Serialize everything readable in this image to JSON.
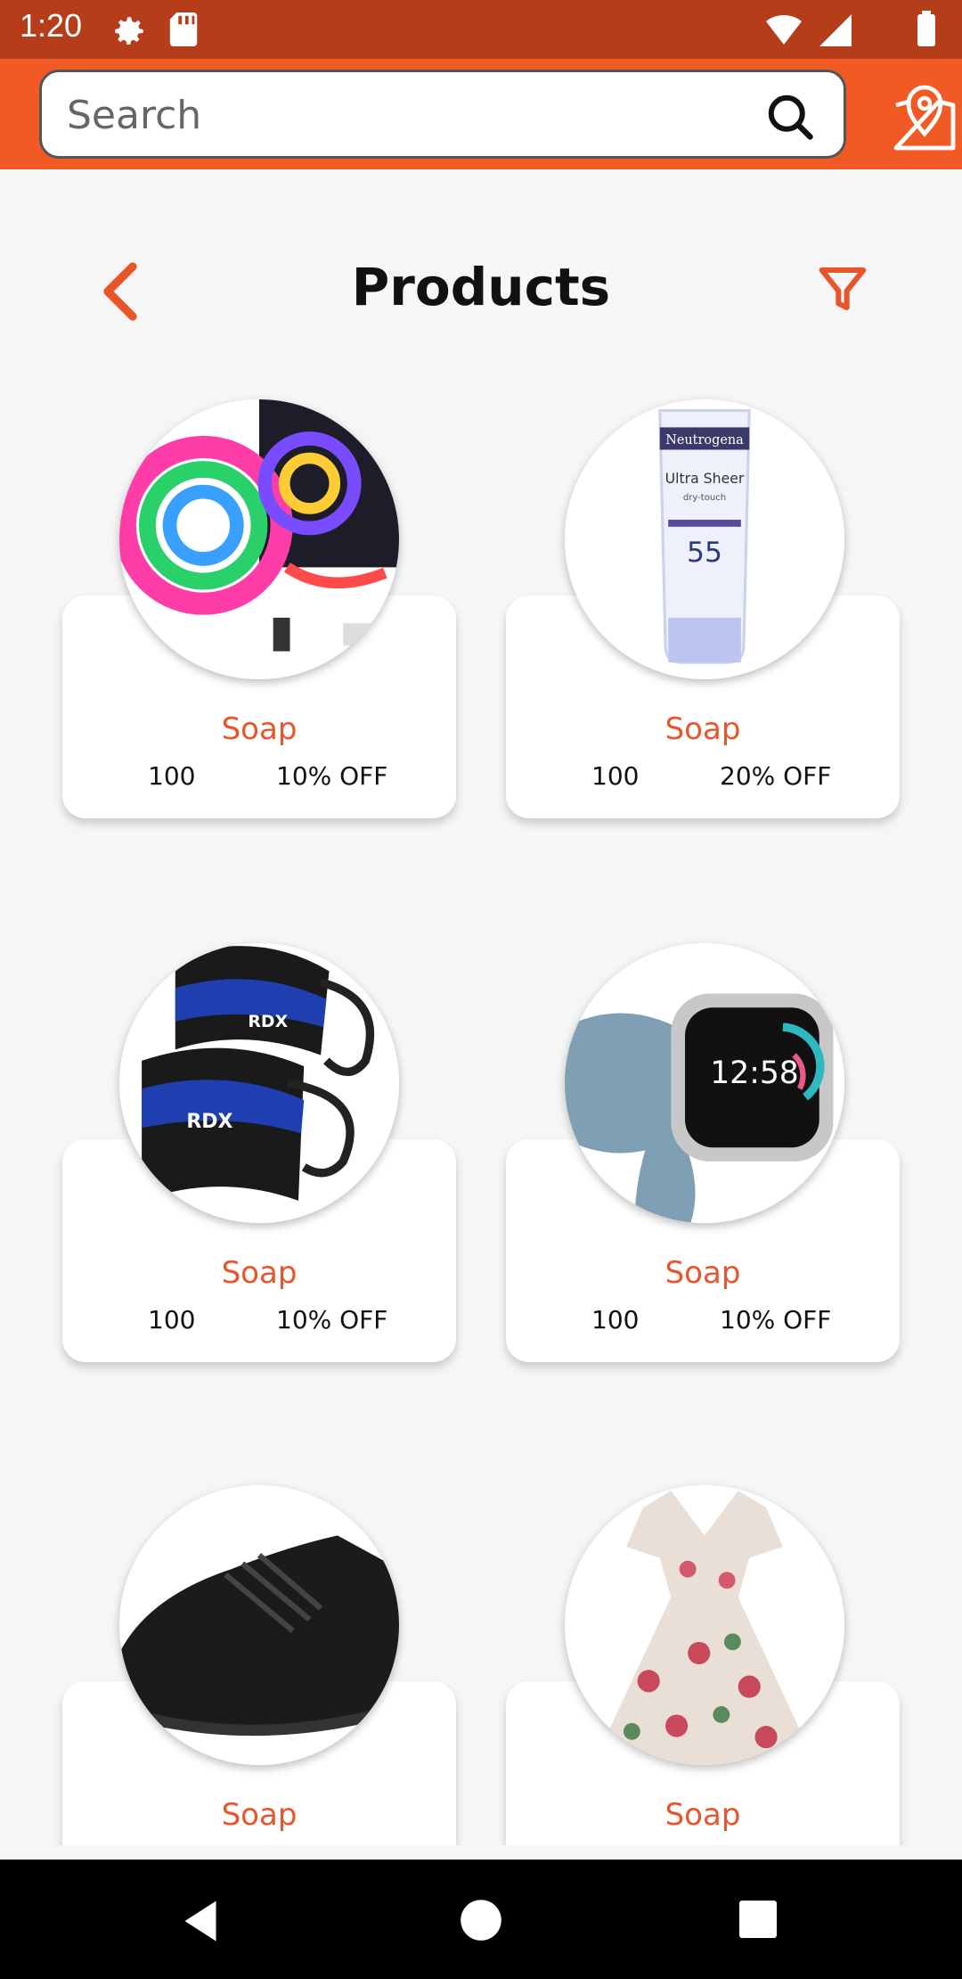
{
  "status_bar": {
    "time": "1:20"
  },
  "search": {
    "placeholder": "Search"
  },
  "header": {
    "title": "Products"
  },
  "products": [
    {
      "name": "Soap",
      "price": "100",
      "discount": "10% OFF",
      "image": "led-strip-lights"
    },
    {
      "name": "Soap",
      "price": "100",
      "discount": "20% OFF",
      "image": "sunscreen-tube"
    },
    {
      "name": "Soap",
      "price": "100",
      "discount": "10% OFF",
      "image": "ankle-straps"
    },
    {
      "name": "Soap",
      "price": "100",
      "discount": "10% OFF",
      "image": "smartwatch"
    },
    {
      "name": "Soap",
      "price": "",
      "discount": "",
      "image": "black-sneaker"
    },
    {
      "name": "Soap",
      "price": "",
      "discount": "",
      "image": "floral-dress"
    }
  ],
  "product_images_text": {
    "sunscreen_brand": "Neutrogena",
    "sunscreen_line": "Ultra Sheer",
    "sunscreen_sub": "dry-touch",
    "sunscreen_spf": "55",
    "watch_time": "12:58",
    "strap_brand": "RDX"
  },
  "colors": {
    "accent": "#f15a24",
    "status_bar": "#b63d1a",
    "price_name": "#e8552b"
  }
}
